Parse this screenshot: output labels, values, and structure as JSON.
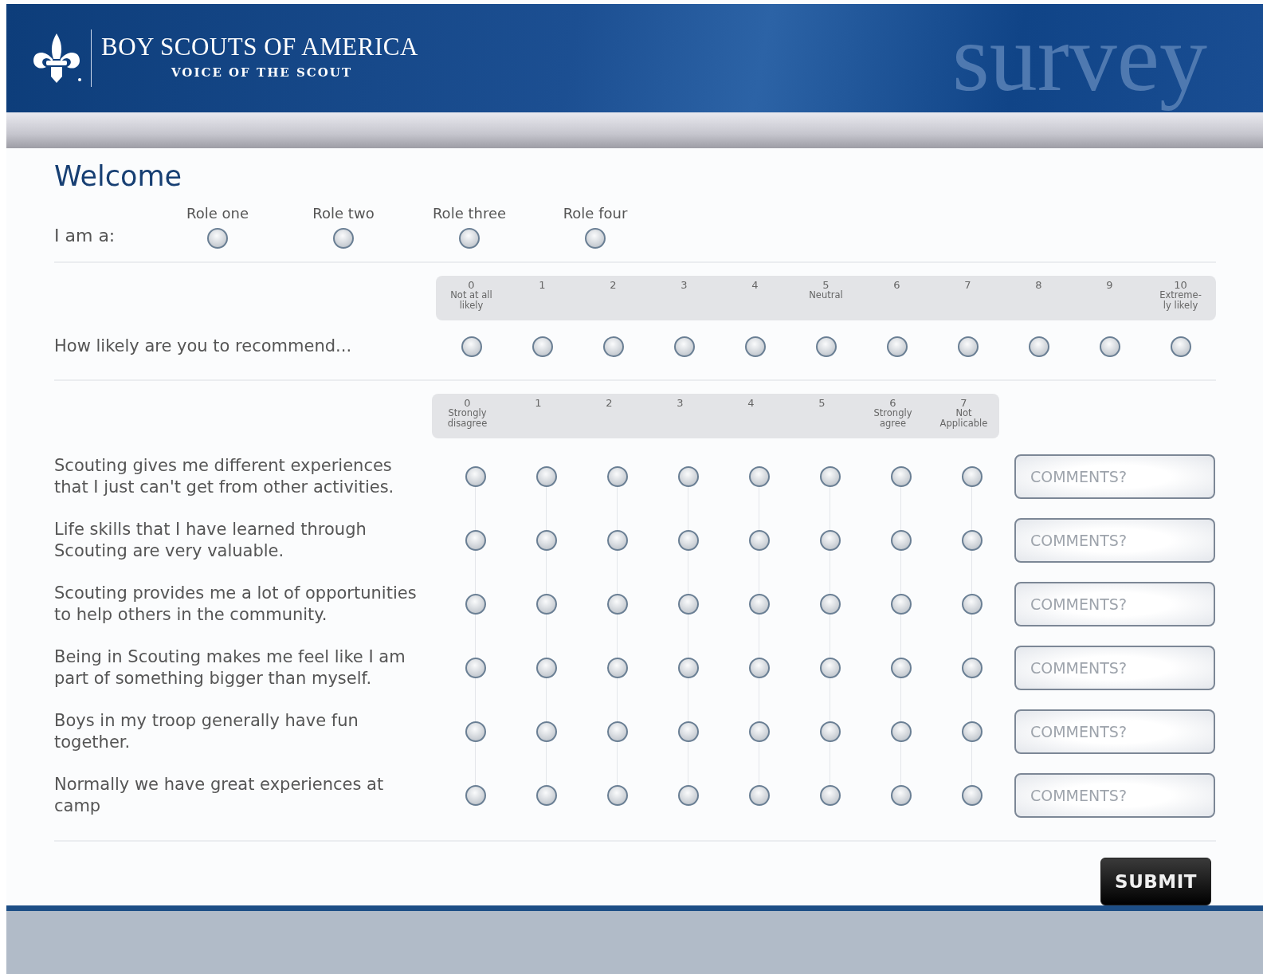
{
  "header": {
    "org": "BOY SCOUTS OF AMERICA",
    "subtitle": "VOICE OF THE SCOUT",
    "watermark": "survey"
  },
  "welcome": {
    "title": "Welcome",
    "prompt": "I am a:",
    "roles": [
      {
        "label": "Role one",
        "selected": false
      },
      {
        "label": "Role two",
        "selected": false
      },
      {
        "label": "Role three",
        "selected": false
      },
      {
        "label": "Role four",
        "selected": false
      }
    ]
  },
  "recommend": {
    "scale": [
      {
        "number": "0",
        "caption": [
          "Not at all",
          "likely"
        ]
      },
      {
        "number": "1"
      },
      {
        "number": "2"
      },
      {
        "number": "3"
      },
      {
        "number": "4"
      },
      {
        "number": "5",
        "caption": [
          "Neutral"
        ]
      },
      {
        "number": "6"
      },
      {
        "number": "7"
      },
      {
        "number": "8"
      },
      {
        "number": "9"
      },
      {
        "number": "10",
        "caption": [
          "Extreme-",
          "ly likely"
        ]
      }
    ],
    "question": "How likely are you to recommend...",
    "options": [
      {
        "selected": false
      },
      {
        "selected": false
      },
      {
        "selected": false
      },
      {
        "selected": false
      },
      {
        "selected": false
      },
      {
        "selected": false
      },
      {
        "selected": false
      },
      {
        "selected": false
      },
      {
        "selected": false
      },
      {
        "selected": false
      },
      {
        "selected": false
      }
    ]
  },
  "agreement": {
    "scale": [
      {
        "number": "0",
        "caption": [
          "Strongly",
          "disagree"
        ]
      },
      {
        "number": "1"
      },
      {
        "number": "2"
      },
      {
        "number": "3"
      },
      {
        "number": "4"
      },
      {
        "number": "5"
      },
      {
        "number": "6",
        "caption": [
          "Strongly",
          "agree"
        ]
      },
      {
        "number": "7",
        "caption": [
          "Not",
          "Applicable"
        ]
      }
    ],
    "questions": [
      {
        "text": "Scouting gives me different experiences that I just can't get from other activities.",
        "comment_placeholder": "COMMENTS?",
        "options": [
          {
            "selected": false
          },
          {
            "selected": false
          },
          {
            "selected": false
          },
          {
            "selected": false
          },
          {
            "selected": false
          },
          {
            "selected": false
          },
          {
            "selected": false
          },
          {
            "selected": false
          }
        ]
      },
      {
        "text": "Life skills that I have learned through Scouting are very valuable.",
        "comment_placeholder": "COMMENTS?",
        "options": [
          {
            "selected": false
          },
          {
            "selected": false
          },
          {
            "selected": false
          },
          {
            "selected": false
          },
          {
            "selected": false
          },
          {
            "selected": false
          },
          {
            "selected": false
          },
          {
            "selected": false
          }
        ]
      },
      {
        "text": "Scouting provides me a lot of opportunities to help others in the community.",
        "comment_placeholder": "COMMENTS?",
        "options": [
          {
            "selected": false
          },
          {
            "selected": false
          },
          {
            "selected": false
          },
          {
            "selected": false
          },
          {
            "selected": false
          },
          {
            "selected": false
          },
          {
            "selected": false
          },
          {
            "selected": false
          }
        ]
      },
      {
        "text": "Being in Scouting makes me feel like I am part of something bigger than myself.",
        "comment_placeholder": "COMMENTS?",
        "options": [
          {
            "selected": false
          },
          {
            "selected": false
          },
          {
            "selected": false
          },
          {
            "selected": false
          },
          {
            "selected": false
          },
          {
            "selected": false
          },
          {
            "selected": false
          },
          {
            "selected": false
          }
        ]
      },
      {
        "text": "Boys in my troop generally have fun together.",
        "comment_placeholder": "COMMENTS?",
        "options": [
          {
            "selected": false
          },
          {
            "selected": false
          },
          {
            "selected": false
          },
          {
            "selected": false
          },
          {
            "selected": false
          },
          {
            "selected": false
          },
          {
            "selected": false
          },
          {
            "selected": false
          }
        ]
      },
      {
        "text": "Normally we have great experiences at camp",
        "comment_placeholder": "COMMENTS?",
        "options": [
          {
            "selected": false
          },
          {
            "selected": false
          },
          {
            "selected": false
          },
          {
            "selected": false
          },
          {
            "selected": false
          },
          {
            "selected": false
          },
          {
            "selected": false
          },
          {
            "selected": false
          }
        ]
      }
    ]
  },
  "submit": "SUBMIT"
}
